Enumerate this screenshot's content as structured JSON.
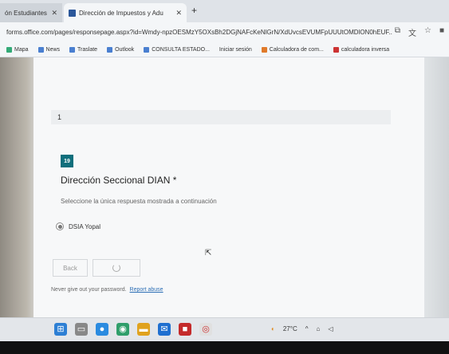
{
  "browser": {
    "tabs": [
      {
        "label": "ón Estudiantes",
        "close": "✕"
      },
      {
        "label": "Dirección de Impuestos y Adu",
        "close": "✕"
      }
    ],
    "new_tab": "+",
    "url": "forms.office.com/pages/responsepage.aspx?id=Wmdy-npzOESMzY5OXsBh2DGjNAFcKeNlGrN/XdUvcsEVUMFpUUUtOMDlON0hEUF...",
    "bookmarks": [
      "Mapa",
      "News",
      "Traslate",
      "Outlook",
      "CONSULTA ESTADO...",
      "Iniciar sesión",
      "Calculadora de com...",
      "calculadora inversa"
    ]
  },
  "form": {
    "previous_answer": "1",
    "question_number": "19",
    "question_title": "Dirección Seccional DIAN *",
    "helper_text": "Seleccione la única respuesta mostrada a continuación",
    "options": [
      "DSIA Yopal"
    ],
    "back_label": "Back",
    "footer_text": "Never give out your password.",
    "report_link": "Report abuse"
  },
  "taskbar": {
    "temperature": "27°C"
  }
}
